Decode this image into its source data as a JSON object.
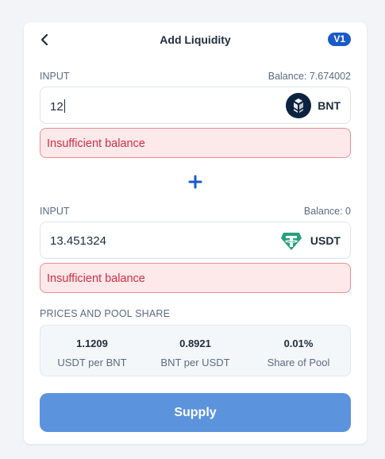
{
  "header": {
    "title": "Add Liquidity",
    "version_badge": "V1"
  },
  "inputs": [
    {
      "label": "INPUT",
      "balance": "Balance: 7.674002",
      "amount": "12",
      "token": "BNT",
      "error": "Insufficient balance"
    },
    {
      "label": "INPUT",
      "balance": "Balance: 0",
      "amount": "13.451324",
      "token": "USDT",
      "error": "Insufficient balance"
    }
  ],
  "pool": {
    "label": "PRICES AND POOL SHARE",
    "items": [
      {
        "value": "1.1209",
        "label": "USDT per BNT"
      },
      {
        "value": "0.8921",
        "label": "BNT per USDT"
      },
      {
        "value": "0.01%",
        "label": "Share of Pool"
      }
    ]
  },
  "actions": {
    "supply_label": "Supply"
  },
  "icons": {
    "back": "back-arrow-icon",
    "plus": "plus-icon",
    "bnt": "bancor-logo-icon",
    "usdt": "tether-logo-icon"
  },
  "colors": {
    "accent": "#1a5ac9",
    "supply_button": "#5b93dd",
    "error_text": "#d12f45",
    "error_bg": "#fde8ea",
    "usdt_green": "#26a17b",
    "bnt_dark": "#0b2240"
  }
}
